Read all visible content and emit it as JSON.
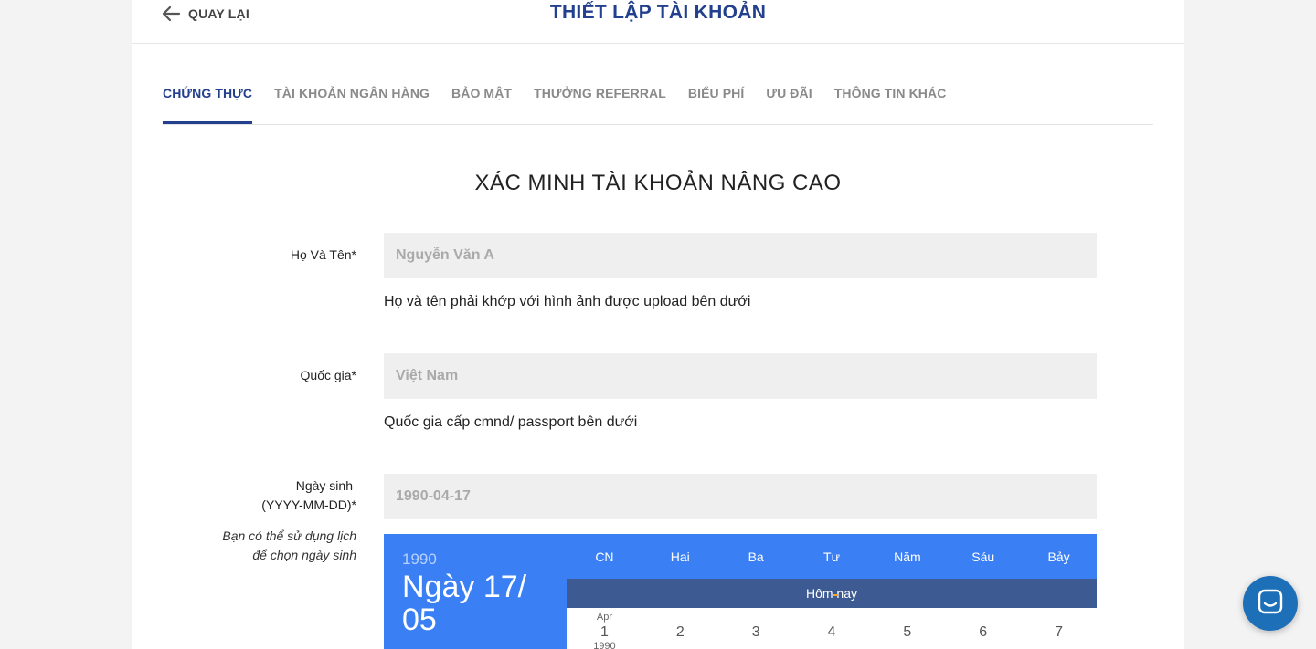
{
  "header": {
    "back_label": "QUAY LẠI",
    "title": "THIẾT LẬP TÀI KHOẢN"
  },
  "tabs": [
    {
      "label": "CHỨNG THỰC",
      "active": true
    },
    {
      "label": "TÀI KHOẢN NGÂN HÀNG",
      "active": false
    },
    {
      "label": "BẢO MẬT",
      "active": false
    },
    {
      "label": "THƯỞNG REFERRAL",
      "active": false
    },
    {
      "label": "BIỂU PHÍ",
      "active": false
    },
    {
      "label": "ƯU ĐÃI",
      "active": false
    },
    {
      "label": "THÔNG TIN KHÁC",
      "active": false
    }
  ],
  "section_title": "XÁC MINH TÀI KHOẢN NÂNG CAO",
  "form": {
    "full_name": {
      "label": "Họ Và Tên*",
      "placeholder": "Nguyễn Văn A",
      "value": "",
      "hint": "Họ và tên phải khớp với hình ảnh được upload bên dưới"
    },
    "country": {
      "label": "Quốc gia*",
      "placeholder": "Việt Nam",
      "value": "",
      "hint": "Quốc gia cấp cmnd/ passport bên dưới"
    },
    "birthday": {
      "label_line1": "Ngày sinh",
      "label_line2": "(YYYY-MM-DD)*",
      "placeholder": "1990-04-17",
      "value": "",
      "note": "Bạn có thể sử dụng lịch để chọn ngày sinh"
    }
  },
  "calendar": {
    "year": "1990",
    "date_label": "Ngày 17/ 05",
    "weekdays": [
      "CN",
      "Hai",
      "Ba",
      "Tư",
      "Năm",
      "Sáu",
      "Bảy"
    ],
    "today_label": "Hôm nay",
    "first_day_month": "Apr",
    "first_day_year": "1990",
    "days": [
      "1",
      "2",
      "3",
      "4",
      "5",
      "6",
      "7"
    ],
    "colors": {
      "header": "#3b7ff5",
      "today_bar": "#3e5a93",
      "today_mark": "#f5a623"
    }
  },
  "chat_widget": {
    "icon": "chat-bubble-icon",
    "color": "#1d6fb8"
  },
  "colors": {
    "brand": "#23408e",
    "input_bg": "#efefef"
  }
}
